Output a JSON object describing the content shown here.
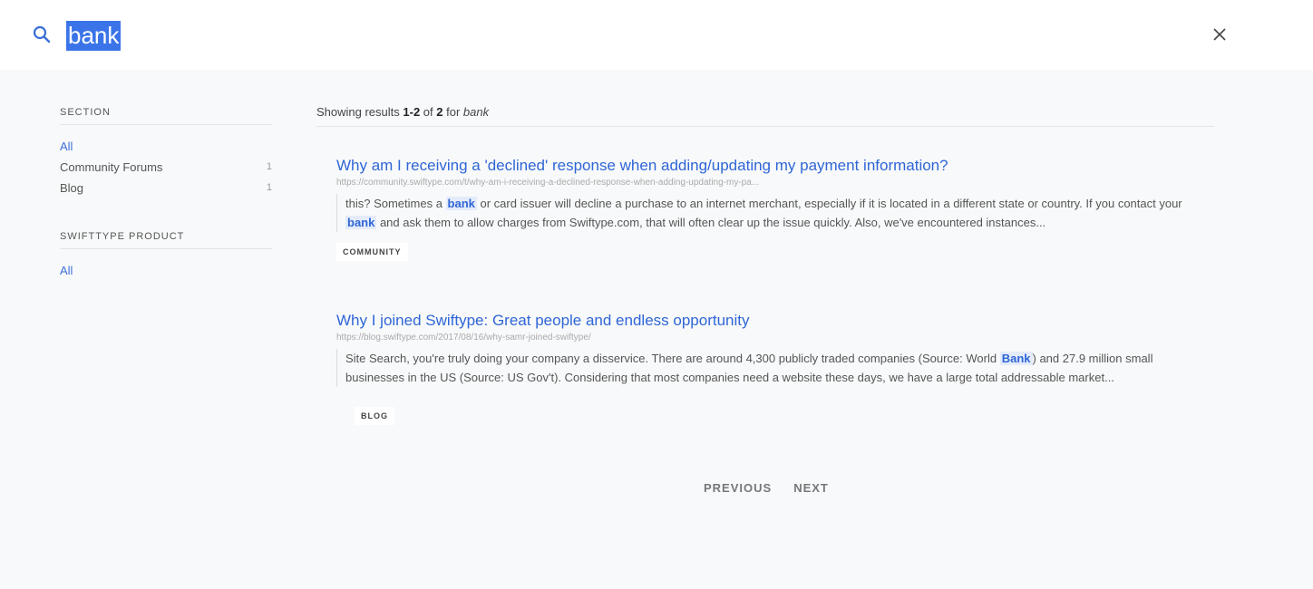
{
  "search": {
    "query": "bank"
  },
  "sidebar": {
    "section": {
      "heading": "SECTION",
      "items": [
        {
          "label": "All",
          "count": ""
        },
        {
          "label": "Community Forums",
          "count": "1"
        },
        {
          "label": "Blog",
          "count": "1"
        }
      ]
    },
    "product": {
      "heading": "SWIFTTYPE PRODUCT",
      "items": [
        {
          "label": "All"
        }
      ]
    }
  },
  "results_header": {
    "prefix": "Showing results ",
    "range": "1-2",
    "of": " of ",
    "total": "2",
    "for": " for ",
    "query": "bank"
  },
  "results": [
    {
      "title": "Why am I receiving a 'declined' response when adding/updating my payment information?",
      "url": "https://community.swiftype.com/t/why-am-i-receiving-a-declined-response-when-adding-updating-my-pa...",
      "snippet": [
        {
          "text": "this? Sometimes a "
        },
        {
          "text": "bank",
          "hl": true
        },
        {
          "text": " or card issuer will decline a purchase to an internet merchant, especially if it is located in a different state or country. If you contact your "
        },
        {
          "text": "bank",
          "hl": true
        },
        {
          "text": " and ask them to allow charges from Swiftype.com, that will often clear up the issue quickly. Also, we've encountered instances..."
        }
      ],
      "tag": "COMMUNITY"
    },
    {
      "title": "Why I joined Swiftype: Great people and endless opportunity",
      "url": "https://blog.swiftype.com/2017/08/16/why-samr-joined-swiftype/",
      "snippet": [
        {
          "text": "Site Search, you're truly doing your company a disservice. There are around 4,300 publicly traded companies (Source: World "
        },
        {
          "text": "Bank",
          "hl": true
        },
        {
          "text": ") and 27.9 million small businesses in the US (Source: US Gov't). Considering that most companies need a website these days, we have a large total addressable market..."
        }
      ],
      "tag": "BLOG"
    }
  ],
  "pagination": {
    "previous": "PREVIOUS",
    "next": "NEXT"
  },
  "colors": {
    "accent": "#2f66d6",
    "selection": "#3b74e8",
    "background": "#f8f9fa"
  }
}
